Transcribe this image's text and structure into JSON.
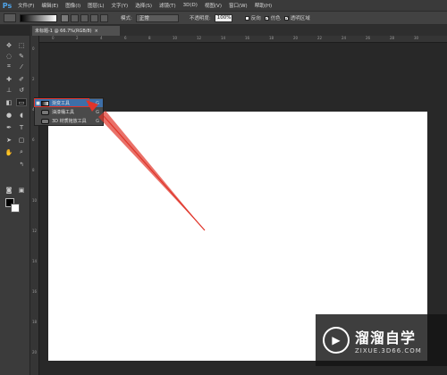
{
  "app": {
    "logo": "Ps"
  },
  "menu": [
    "文件(F)",
    "编辑(E)",
    "图像(I)",
    "图层(L)",
    "文字(Y)",
    "选择(S)",
    "滤镜(T)",
    "3D(D)",
    "视图(V)",
    "窗口(W)",
    "帮助(H)"
  ],
  "options": {
    "mode_label": "模式:",
    "mode_value": "正常",
    "opacity_label": "不透明度:",
    "opacity_value": "100%",
    "reverse_label": "反向",
    "dither_label": "仿色",
    "transparency_label": "透明区域"
  },
  "document": {
    "tab_title": "未标题-1 @ 66.7%(RGB/8)",
    "close": "×"
  },
  "ruler_x": [
    "0",
    "2",
    "4",
    "6",
    "8",
    "10",
    "12",
    "14",
    "16",
    "18",
    "20",
    "22",
    "24",
    "26",
    "28",
    "30"
  ],
  "ruler_y": [
    "0",
    "2",
    "4",
    "6",
    "8",
    "10",
    "12",
    "14",
    "16",
    "18",
    "20"
  ],
  "flyout": {
    "items": [
      {
        "label": "渐变工具",
        "key": "G",
        "selected": true
      },
      {
        "label": "油漆桶工具",
        "key": "G",
        "selected": false
      },
      {
        "label": "3D 材质拖放工具",
        "key": "G",
        "selected": false
      }
    ]
  },
  "colors": {
    "foreground": "#000000",
    "background": "#ffffff",
    "annotation": "#e0342a",
    "accent": "#4fa3e8"
  },
  "watermark": {
    "title": "溜溜自学",
    "subtitle": "ZIXUE.3D66.COM"
  }
}
